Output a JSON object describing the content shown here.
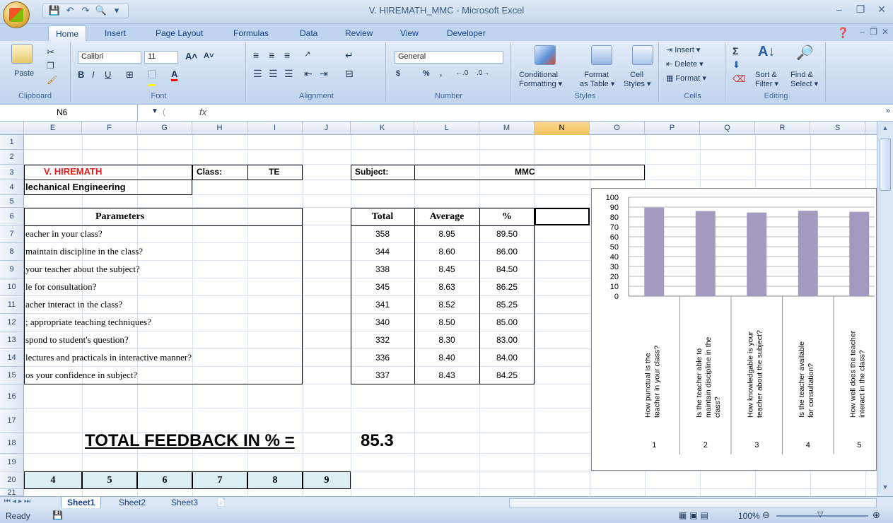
{
  "window": {
    "title": "V. HIREMATH_MMC - Microsoft Excel"
  },
  "tabs": [
    "Home",
    "Insert",
    "Page Layout",
    "Formulas",
    "Data",
    "Review",
    "View",
    "Developer"
  ],
  "ribbon": {
    "clipboard": {
      "label": "Clipboard",
      "paste": "Paste"
    },
    "font": {
      "label": "Font",
      "name": "Calibri",
      "size": "11"
    },
    "alignment": {
      "label": "Alignment"
    },
    "number": {
      "label": "Number",
      "format": "General",
      "currency": "$",
      "percent": "%",
      "comma": ","
    },
    "styles": {
      "label": "Styles",
      "conditional": "Conditional",
      "formatting": "Formatting",
      "format_as": "Format",
      "as_table": "as Table",
      "cell": "Cell",
      "cell_styles": "Styles"
    },
    "cells": {
      "label": "Cells",
      "insert": "Insert",
      "delete": "Delete",
      "format": "Format"
    },
    "editing": {
      "label": "Editing",
      "sort": "Sort &",
      "filter": "Filter",
      "find": "Find &",
      "select": "Select"
    }
  },
  "formula_bar": {
    "name_box": "N6",
    "fx": "fx"
  },
  "columns": [
    "E",
    "F",
    "G",
    "H",
    "I",
    "J",
    "K",
    "L",
    "M",
    "N",
    "O",
    "P",
    "Q",
    "R",
    "S"
  ],
  "rows": [
    "1",
    "2",
    "3",
    "4",
    "5",
    "6",
    "7",
    "8",
    "9",
    "10",
    "11",
    "12",
    "13",
    "14",
    "15",
    "16",
    "17",
    "18",
    "19",
    "20",
    "21"
  ],
  "sheet": {
    "name": "V. HIREMATH",
    "class_label": "Class:",
    "class_value": "TE",
    "subject_label": "Subject:",
    "subject_value": "MMC",
    "dept": "lechanical Engineering",
    "params_header": "Parameters",
    "total_header": "Total",
    "average_header": "Average",
    "percent_header": "%",
    "params": [
      "eacher in your class?",
      " maintain discipline in the class?",
      " your teacher about the subject?",
      "le for consultation?",
      "acher interact in the class?",
      "; appropriate teaching techniques?",
      "spond to student's question?",
      " lectures and practicals in interactive manner?",
      "os your confidence in subject?"
    ],
    "totals": [
      "358",
      "344",
      "338",
      "345",
      "341",
      "340",
      "332",
      "336",
      "337"
    ],
    "averages": [
      "8.95",
      "8.60",
      "8.45",
      "8.63",
      "8.52",
      "8.50",
      "8.30",
      "8.40",
      "8.43"
    ],
    "percents": [
      "89.50",
      "86.00",
      "84.50",
      "86.25",
      "85.25",
      "85.00",
      "83.00",
      "84.00",
      "84.25"
    ],
    "total_feedback_label": "TOTAL FEEDBACK IN % =",
    "total_feedback_value": "85.3",
    "row20": [
      "4",
      "5",
      "6",
      "7",
      "8",
      "9"
    ]
  },
  "chart_data": {
    "type": "bar",
    "categories": [
      "1",
      "2",
      "3",
      "4",
      "5"
    ],
    "category_labels": [
      "How punctual is the teacher in your class?",
      "Is the teacher able to maintain discipline in the class?",
      "How knowledgable is your teacher about the subject?",
      "Is the teacher available for consultation?",
      "How well does the teacher interact in the class?"
    ],
    "values": [
      89.5,
      86.0,
      84.5,
      86.25,
      85.25
    ],
    "ylim": [
      0,
      100
    ],
    "yticks": [
      "100",
      "90",
      "80",
      "70",
      "60",
      "50",
      "40",
      "30",
      "20",
      "10",
      "0"
    ],
    "bar_color": "#a49ac0",
    "grid": true
  },
  "sheet_tabs": [
    "Sheet1",
    "Sheet2",
    "Sheet3"
  ],
  "status": {
    "ready": "Ready",
    "zoom": "100%"
  }
}
